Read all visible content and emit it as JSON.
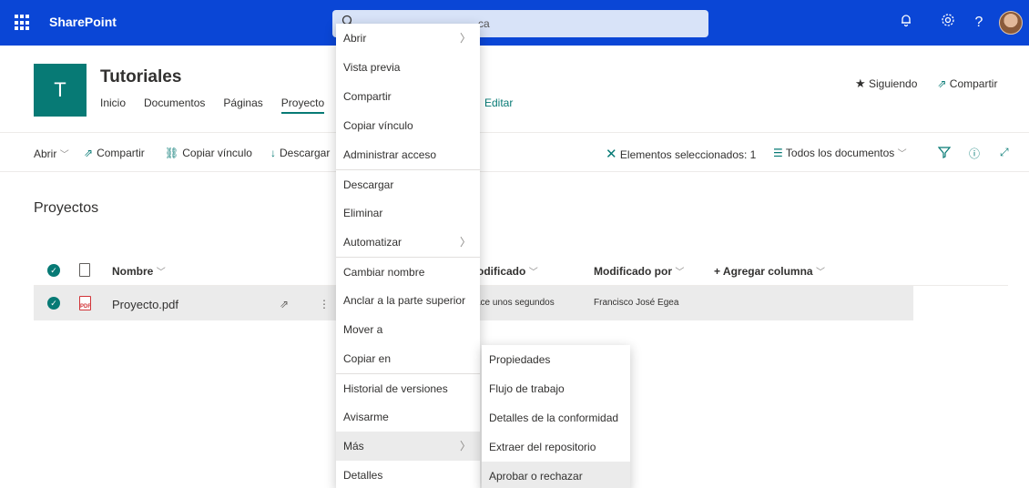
{
  "suitebar": {
    "app_name": "SharePoint",
    "search_placeholder_visible": "ca",
    "colors": {
      "bar": "#0a46d6"
    }
  },
  "site": {
    "logo_letter": "T",
    "title": "Tutoriales",
    "nav": [
      "Inicio",
      "Documentos",
      "Páginas",
      "Proyecto"
    ],
    "edit": "Editar",
    "follow": "Siguiendo",
    "share": "Compartir",
    "accent": "#077a75"
  },
  "commandbar": {
    "open": "Abrir",
    "share": "Compartir",
    "copy_link": "Copiar vínculo",
    "download": "Descargar",
    "selected": "Elementos seleccionados: 1",
    "view": "Todos los documentos"
  },
  "library": {
    "title": "Proyectos",
    "columns": {
      "name": "Nombre",
      "modified": "odificado",
      "modified_by": "Modificado por",
      "add_column": "+ Agregar columna"
    },
    "rows": [
      {
        "name": "Proyecto.pdf",
        "modified": "ace unos segundos",
        "modified_by": "Francisco José Egea"
      }
    ]
  },
  "context_menu": {
    "items": [
      {
        "label": "Abrir",
        "submenu": true
      },
      {
        "label": "Vista previa"
      },
      {
        "label": "Compartir"
      },
      {
        "label": "Copiar vínculo"
      },
      {
        "label": "Administrar acceso"
      },
      {
        "label": "Descargar"
      },
      {
        "label": "Eliminar"
      },
      {
        "label": "Automatizar",
        "submenu": true
      },
      {
        "label": "Cambiar nombre"
      },
      {
        "label": "Anclar a la parte superior"
      },
      {
        "label": "Mover a"
      },
      {
        "label": "Copiar en"
      },
      {
        "label": "Historial de versiones"
      },
      {
        "label": "Avisarme"
      },
      {
        "label": "Más",
        "submenu": true
      },
      {
        "label": "Detalles"
      }
    ]
  },
  "submenu": {
    "items": [
      {
        "label": "Propiedades"
      },
      {
        "label": "Flujo de trabajo"
      },
      {
        "label": "Detalles de la conformidad"
      },
      {
        "label": "Extraer del repositorio"
      },
      {
        "label": "Aprobar o rechazar"
      }
    ]
  }
}
